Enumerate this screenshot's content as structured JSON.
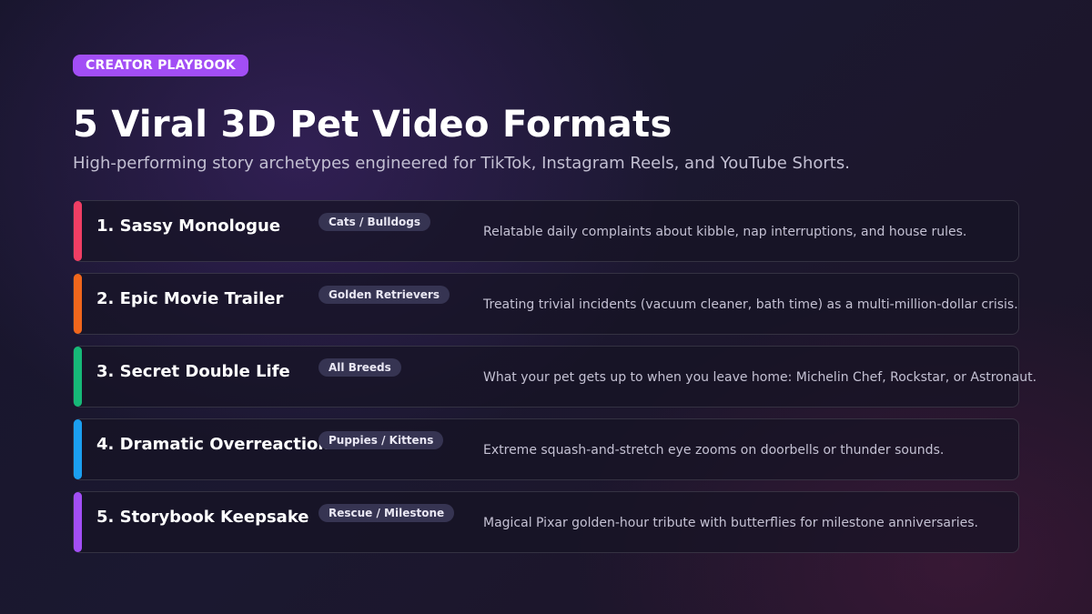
{
  "header": {
    "badge": "CREATOR PLAYBOOK",
    "title": "5 Viral 3D Pet Video Formats",
    "subtitle": "High-performing story archetypes engineered for TikTok, Instagram Reels, and YouTube Shorts."
  },
  "formats": [
    {
      "title": "1. Sassy Monologue",
      "tag": "Cats / Bulldogs",
      "description": "Relatable daily complaints about kibble, nap interruptions, and house rules.",
      "accent_color": "#f03e64"
    },
    {
      "title": "2. Epic Movie Trailer",
      "tag": "Golden Retrievers",
      "description": "Treating trivial incidents (vacuum cleaner, bath time) as a multi-million-dollar crisis.",
      "accent_color": "#f0661c"
    },
    {
      "title": "3. Secret Double Life",
      "tag": "All Breeds",
      "description": "What your pet gets up to when you leave home: Michelin Chef, Rockstar, or Astronaut.",
      "accent_color": "#16b978"
    },
    {
      "title": "4. Dramatic Overreaction",
      "tag": "Puppies / Kittens",
      "description": "Extreme squash-and-stretch eye zooms on doorbells or thunder sounds.",
      "accent_color": "#1b9ff0"
    },
    {
      "title": "5. Storybook Keepsake",
      "tag": "Rescue / Milestone",
      "description": "Magical Pixar golden-hour tribute with butterflies for milestone anniversaries.",
      "accent_color": "#a24ef5"
    }
  ]
}
